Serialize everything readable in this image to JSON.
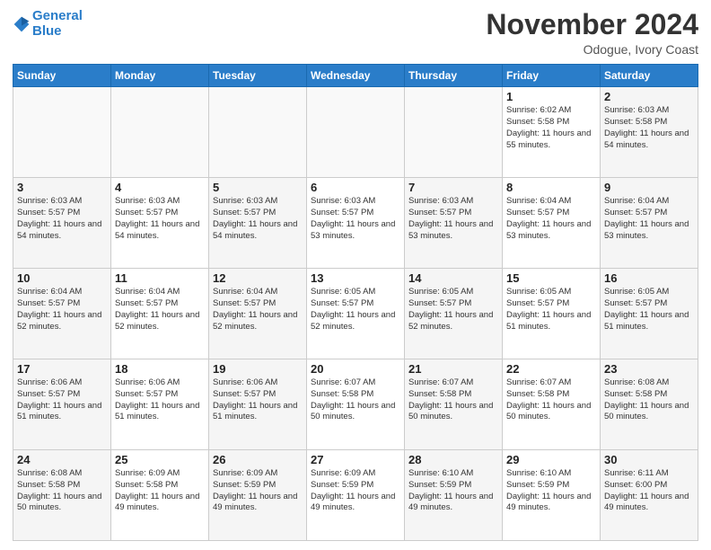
{
  "header": {
    "logo_line1": "General",
    "logo_line2": "Blue",
    "month": "November 2024",
    "location": "Odogue, Ivory Coast"
  },
  "weekdays": [
    "Sunday",
    "Monday",
    "Tuesday",
    "Wednesday",
    "Thursday",
    "Friday",
    "Saturday"
  ],
  "weeks": [
    [
      {
        "day": "",
        "info": ""
      },
      {
        "day": "",
        "info": ""
      },
      {
        "day": "",
        "info": ""
      },
      {
        "day": "",
        "info": ""
      },
      {
        "day": "",
        "info": ""
      },
      {
        "day": "1",
        "info": "Sunrise: 6:02 AM\nSunset: 5:58 PM\nDaylight: 11 hours and 55 minutes."
      },
      {
        "day": "2",
        "info": "Sunrise: 6:03 AM\nSunset: 5:58 PM\nDaylight: 11 hours and 54 minutes."
      }
    ],
    [
      {
        "day": "3",
        "info": "Sunrise: 6:03 AM\nSunset: 5:57 PM\nDaylight: 11 hours and 54 minutes."
      },
      {
        "day": "4",
        "info": "Sunrise: 6:03 AM\nSunset: 5:57 PM\nDaylight: 11 hours and 54 minutes."
      },
      {
        "day": "5",
        "info": "Sunrise: 6:03 AM\nSunset: 5:57 PM\nDaylight: 11 hours and 54 minutes."
      },
      {
        "day": "6",
        "info": "Sunrise: 6:03 AM\nSunset: 5:57 PM\nDaylight: 11 hours and 53 minutes."
      },
      {
        "day": "7",
        "info": "Sunrise: 6:03 AM\nSunset: 5:57 PM\nDaylight: 11 hours and 53 minutes."
      },
      {
        "day": "8",
        "info": "Sunrise: 6:04 AM\nSunset: 5:57 PM\nDaylight: 11 hours and 53 minutes."
      },
      {
        "day": "9",
        "info": "Sunrise: 6:04 AM\nSunset: 5:57 PM\nDaylight: 11 hours and 53 minutes."
      }
    ],
    [
      {
        "day": "10",
        "info": "Sunrise: 6:04 AM\nSunset: 5:57 PM\nDaylight: 11 hours and 52 minutes."
      },
      {
        "day": "11",
        "info": "Sunrise: 6:04 AM\nSunset: 5:57 PM\nDaylight: 11 hours and 52 minutes."
      },
      {
        "day": "12",
        "info": "Sunrise: 6:04 AM\nSunset: 5:57 PM\nDaylight: 11 hours and 52 minutes."
      },
      {
        "day": "13",
        "info": "Sunrise: 6:05 AM\nSunset: 5:57 PM\nDaylight: 11 hours and 52 minutes."
      },
      {
        "day": "14",
        "info": "Sunrise: 6:05 AM\nSunset: 5:57 PM\nDaylight: 11 hours and 52 minutes."
      },
      {
        "day": "15",
        "info": "Sunrise: 6:05 AM\nSunset: 5:57 PM\nDaylight: 11 hours and 51 minutes."
      },
      {
        "day": "16",
        "info": "Sunrise: 6:05 AM\nSunset: 5:57 PM\nDaylight: 11 hours and 51 minutes."
      }
    ],
    [
      {
        "day": "17",
        "info": "Sunrise: 6:06 AM\nSunset: 5:57 PM\nDaylight: 11 hours and 51 minutes."
      },
      {
        "day": "18",
        "info": "Sunrise: 6:06 AM\nSunset: 5:57 PM\nDaylight: 11 hours and 51 minutes."
      },
      {
        "day": "19",
        "info": "Sunrise: 6:06 AM\nSunset: 5:57 PM\nDaylight: 11 hours and 51 minutes."
      },
      {
        "day": "20",
        "info": "Sunrise: 6:07 AM\nSunset: 5:58 PM\nDaylight: 11 hours and 50 minutes."
      },
      {
        "day": "21",
        "info": "Sunrise: 6:07 AM\nSunset: 5:58 PM\nDaylight: 11 hours and 50 minutes."
      },
      {
        "day": "22",
        "info": "Sunrise: 6:07 AM\nSunset: 5:58 PM\nDaylight: 11 hours and 50 minutes."
      },
      {
        "day": "23",
        "info": "Sunrise: 6:08 AM\nSunset: 5:58 PM\nDaylight: 11 hours and 50 minutes."
      }
    ],
    [
      {
        "day": "24",
        "info": "Sunrise: 6:08 AM\nSunset: 5:58 PM\nDaylight: 11 hours and 50 minutes."
      },
      {
        "day": "25",
        "info": "Sunrise: 6:09 AM\nSunset: 5:58 PM\nDaylight: 11 hours and 49 minutes."
      },
      {
        "day": "26",
        "info": "Sunrise: 6:09 AM\nSunset: 5:59 PM\nDaylight: 11 hours and 49 minutes."
      },
      {
        "day": "27",
        "info": "Sunrise: 6:09 AM\nSunset: 5:59 PM\nDaylight: 11 hours and 49 minutes."
      },
      {
        "day": "28",
        "info": "Sunrise: 6:10 AM\nSunset: 5:59 PM\nDaylight: 11 hours and 49 minutes."
      },
      {
        "day": "29",
        "info": "Sunrise: 6:10 AM\nSunset: 5:59 PM\nDaylight: 11 hours and 49 minutes."
      },
      {
        "day": "30",
        "info": "Sunrise: 6:11 AM\nSunset: 6:00 PM\nDaylight: 11 hours and 49 minutes."
      }
    ]
  ]
}
